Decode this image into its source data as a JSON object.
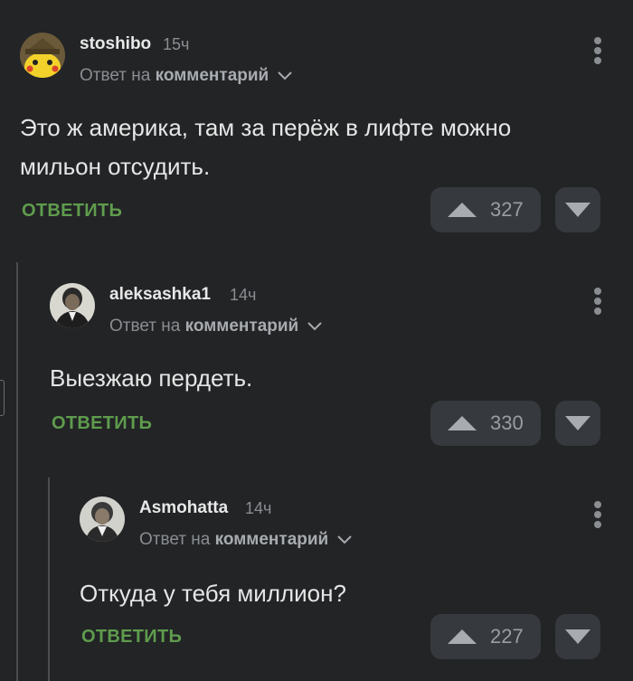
{
  "comments": [
    {
      "username": "stoshibo",
      "time": "15ч",
      "reply_prefix": "Ответ на",
      "reply_target": "комментарий",
      "text_lines": [
        "Это ж америка, там за перёж в лифте можно",
        "мильон отсудить."
      ],
      "reply_label": "ОТВЕТИТЬ",
      "votes": "327",
      "avatar": "pikachu-avatar"
    },
    {
      "username": "aleksashka1",
      "time": "14ч",
      "reply_prefix": "Ответ на",
      "reply_target": "комментарий",
      "text_lines": [
        "Выезжаю пердеть."
      ],
      "reply_label": "ОТВЕТИТЬ",
      "votes": "330",
      "avatar": "portrait-avatar"
    },
    {
      "username": "Asmohatta",
      "time": "14ч",
      "reply_prefix": "Ответ на",
      "reply_target": "комментарий",
      "text_lines": [
        "Откуда у тебя миллион?"
      ],
      "reply_label": "ОТВЕТИТЬ",
      "votes": "227",
      "avatar": "portrait-avatar"
    }
  ],
  "colors": {
    "background": "#222426",
    "reply_green": "#5f9c4d",
    "vote_bg": "#36393d",
    "muted": "#8a8d91"
  }
}
